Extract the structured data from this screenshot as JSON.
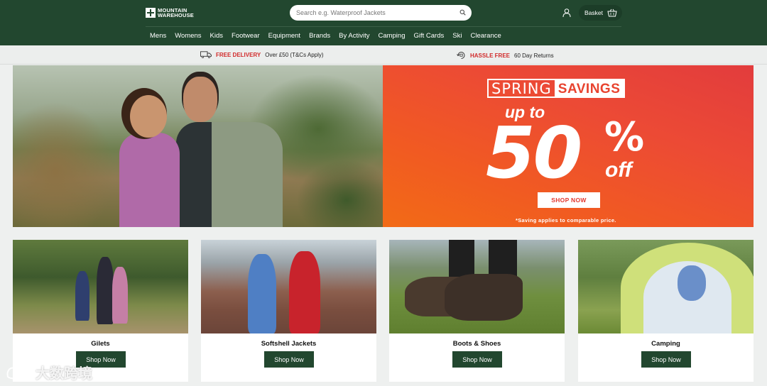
{
  "brand": {
    "logo_line1": "MOUNTAIN",
    "logo_line2": "WAREHOUSE"
  },
  "search": {
    "placeholder": "Search e.g. Waterproof Jackets"
  },
  "header": {
    "basket_label": "Basket"
  },
  "nav": {
    "items": [
      "Mens",
      "Womens",
      "Kids",
      "Footwear",
      "Equipment",
      "Brands",
      "By Activity",
      "Camping",
      "Gift Cards",
      "Ski",
      "Clearance"
    ]
  },
  "usp": {
    "delivery_highlight": "FREE DELIVERY",
    "delivery_text": "Over £50 (T&Cs Apply)",
    "returns_highlight": "HASSLE FREE",
    "returns_text": "60 Day Returns"
  },
  "hero": {
    "title_word1": "SPRING",
    "title_word2": "SAVINGS",
    "upto": "up to",
    "percent_number": "50",
    "percent_symbol": "%",
    "off": "off",
    "cta": "SHOP NOW",
    "note": "*Saving applies to comparable price."
  },
  "categories": [
    {
      "title": "Gilets",
      "cta": "Shop Now"
    },
    {
      "title": "Softshell Jackets",
      "cta": "Shop Now"
    },
    {
      "title": "Boots & Shoes",
      "cta": "Shop Now"
    },
    {
      "title": "Camping",
      "cta": "Shop Now"
    }
  ],
  "watermark": {
    "text": "大数跨境"
  },
  "colors": {
    "header_bg": "#22472f",
    "accent_red": "#d12b2b",
    "promo_orange": "#f15a22",
    "button_green": "#22472f"
  },
  "icons": [
    "search-icon",
    "account-icon",
    "basket-icon",
    "truck-icon",
    "returns-icon"
  ]
}
